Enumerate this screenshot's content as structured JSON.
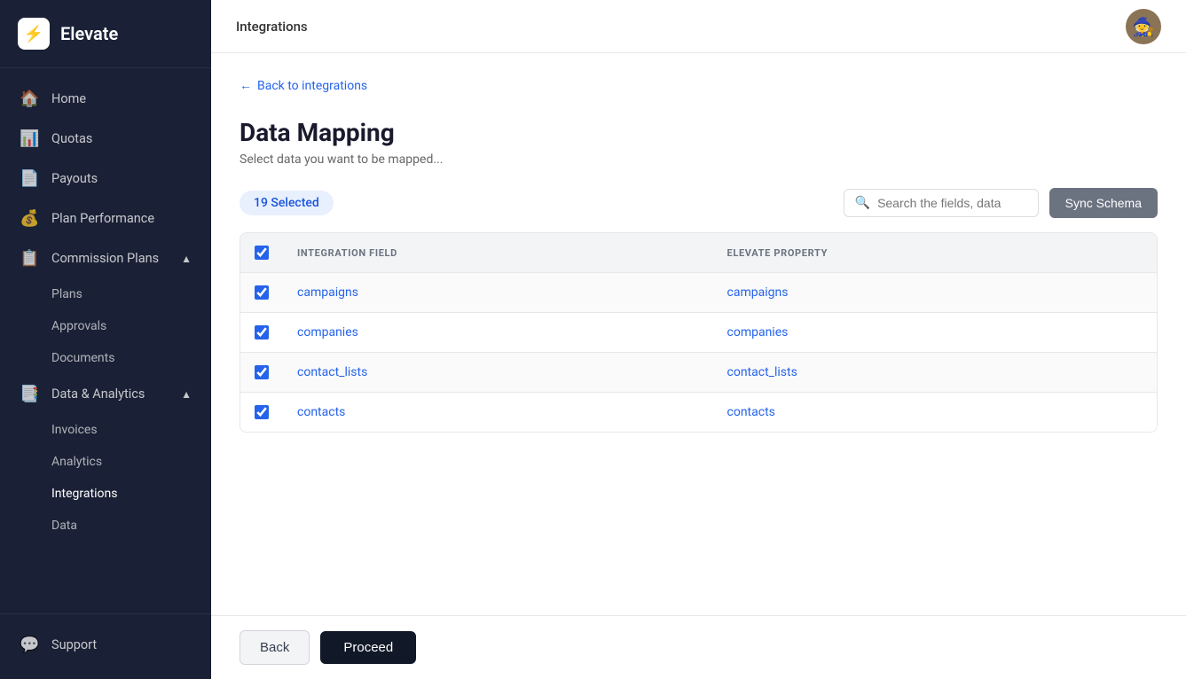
{
  "app": {
    "name": "Elevate",
    "logo_symbol": "⚡"
  },
  "topbar": {
    "title": "Integrations"
  },
  "sidebar": {
    "nav_items": [
      {
        "id": "home",
        "label": "Home",
        "icon": "🏠",
        "type": "item"
      },
      {
        "id": "quotas",
        "label": "Quotas",
        "icon": "📊",
        "type": "item"
      },
      {
        "id": "payouts",
        "label": "Payouts",
        "icon": "📄",
        "type": "item"
      },
      {
        "id": "plan-performance",
        "label": "Plan Performance",
        "icon": "💰",
        "type": "item"
      },
      {
        "id": "commission-plans",
        "label": "Commission Plans",
        "icon": "📋",
        "type": "section",
        "expanded": true,
        "children": [
          {
            "id": "plans",
            "label": "Plans"
          },
          {
            "id": "approvals",
            "label": "Approvals"
          },
          {
            "id": "documents",
            "label": "Documents"
          }
        ]
      },
      {
        "id": "data-analytics",
        "label": "Data & Analytics",
        "icon": "📑",
        "type": "section",
        "expanded": true,
        "children": [
          {
            "id": "invoices",
            "label": "Invoices"
          },
          {
            "id": "analytics",
            "label": "Analytics"
          },
          {
            "id": "integrations",
            "label": "Integrations",
            "active": true
          },
          {
            "id": "data",
            "label": "Data"
          }
        ]
      }
    ],
    "bottom_items": [
      {
        "id": "support",
        "label": "Support",
        "icon": "💬"
      }
    ]
  },
  "page": {
    "back_link": "Back to integrations",
    "title": "Data Mapping",
    "subtitle": "Select data you want to be mapped...",
    "selected_badge": "19 Selected",
    "search_placeholder": "Search the fields, data",
    "sync_button": "Sync Schema"
  },
  "table": {
    "columns": [
      {
        "id": "checkbox",
        "label": ""
      },
      {
        "id": "integration_field",
        "label": "INTEGRATION FIELD"
      },
      {
        "id": "elevate_property",
        "label": "ELEVATE PROPERTY"
      }
    ],
    "rows": [
      {
        "id": 1,
        "checked": true,
        "integration_field": "campaigns",
        "elevate_property": "campaigns"
      },
      {
        "id": 2,
        "checked": true,
        "integration_field": "companies",
        "elevate_property": "companies"
      },
      {
        "id": 3,
        "checked": true,
        "integration_field": "contact_lists",
        "elevate_property": "contact_lists"
      },
      {
        "id": 4,
        "checked": true,
        "integration_field": "contacts",
        "elevate_property": "contacts"
      }
    ]
  },
  "footer": {
    "back_button": "Back",
    "proceed_button": "Proceed"
  }
}
